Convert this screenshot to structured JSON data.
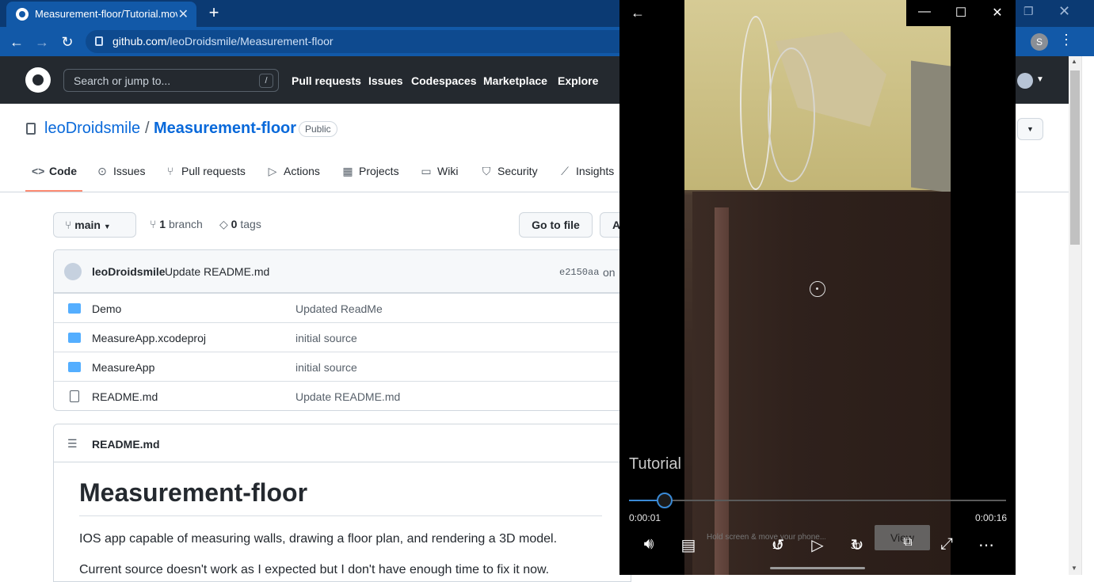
{
  "browser": {
    "tab_title": "Measurement-floor/Tutorial.mov",
    "url_host": "github.com",
    "url_path": "/leoDroidsmile/Measurement-floor",
    "profile_initial": "S"
  },
  "gh_header": {
    "search_placeholder": "Search or jump to...",
    "search_key": "/",
    "nav": [
      "Pull requests",
      "Issues",
      "Codespaces",
      "Marketplace",
      "Explore"
    ]
  },
  "repo": {
    "owner": "leoDroidsmile",
    "separator": "/",
    "name": "Measurement-floor",
    "visibility": "Public"
  },
  "repo_tabs": [
    "Code",
    "Issues",
    "Pull requests",
    "Actions",
    "Projects",
    "Wiki",
    "Security",
    "Insights"
  ],
  "branch_bar": {
    "branch": "main",
    "branch_count": "1",
    "branch_label": "branch",
    "tag_count": "0",
    "tag_label": "tags",
    "goto_file": "Go to file",
    "add_file_partial": "A"
  },
  "commit": {
    "author": "leoDroidsmile",
    "message": "Update README.md",
    "sha": "e2150aa",
    "on": "on"
  },
  "files": [
    {
      "name": "Demo",
      "type": "folder",
      "message": "Updated ReadMe"
    },
    {
      "name": "MeasureApp.xcodeproj",
      "type": "folder",
      "message": "initial source"
    },
    {
      "name": "MeasureApp",
      "type": "folder",
      "message": "initial source"
    },
    {
      "name": "README.md",
      "type": "file",
      "message": "Update README.md"
    }
  ],
  "readme": {
    "file_label": "README.md",
    "heading": "Measurement-floor",
    "paragraphs": [
      "IOS app capable of measuring walls, drawing a floor plan, and rendering a 3D model.",
      "Current source doesn't work as I expected but I don't have enough time to fix it now."
    ]
  },
  "player": {
    "title": "Tutorial",
    "current_time": "0:00:01",
    "duration": "0:00:16",
    "progress_fraction": 0.094,
    "hint": "Hold screen & move your phone...",
    "skip_back": "10",
    "skip_forward": "30",
    "view_label": "View",
    "accent": "#3a8ad6"
  }
}
